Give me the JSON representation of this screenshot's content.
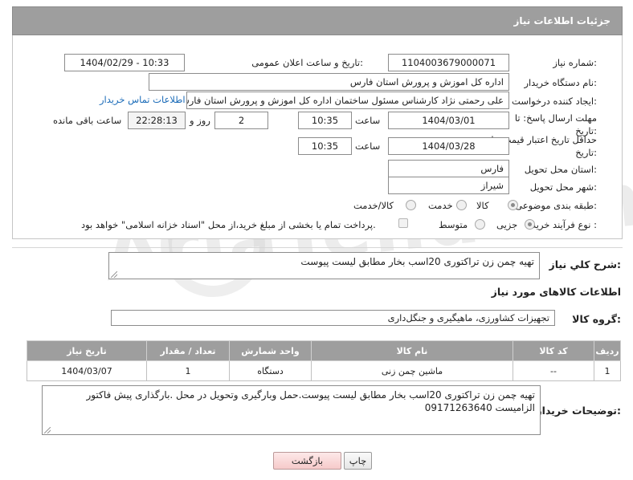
{
  "header": {
    "title": "جزئیات اطلاعات نیاز"
  },
  "fields": {
    "need_number": {
      "label": "شماره نیاز:",
      "value": "1104003679000071"
    },
    "announce_date": {
      "label": "تاریخ و ساعت اعلان عمومی:",
      "value": "1404/02/29 - 10:33"
    },
    "buyer_org": {
      "label": "نام دستگاه خریدار:",
      "value": "اداره کل اموزش و پرورش استان فارس"
    },
    "creator": {
      "label": "ایجاد کننده درخواست:",
      "value": "علی رحمتی نژاد کارشناس مسئول ساختمان اداره کل اموزش و پرورش استان فارس",
      "link": "اطلاعات تماس خریدار"
    },
    "reply_deadline": {
      "label": "مهلت ارسال پاسخ: تا تاریخ:",
      "date": "1404/03/01",
      "time_label": "ساعت",
      "time": "10:35",
      "days": "2",
      "days_label": "روز و",
      "remaining": "22:28:13",
      "remaining_label": "ساعت باقی مانده"
    },
    "price_deadline": {
      "label": "حداقل تاریخ اعتبار قیمت: تا تاریخ:",
      "date": "1404/03/28",
      "time_label": "ساعت",
      "time": "10:35"
    },
    "delivery_province": {
      "label": "استان محل تحویل:",
      "value": "فارس"
    },
    "delivery_city": {
      "label": "شهر محل تحویل:",
      "value": "شیراز"
    },
    "category": {
      "label": "طبقه بندی موضوعی:",
      "options": [
        "کالا",
        "خدمت",
        "کالا/خدمت"
      ],
      "selected": "کالا"
    },
    "process": {
      "label": "نوع فرآیند خرید :",
      "options": [
        "جزیی",
        "متوسط"
      ],
      "selected": "جزیی",
      "note": "پرداخت تمام یا بخشی از مبلغ خرید،از محل \"اسناد خزانه اسلامی\" خواهد بود."
    }
  },
  "description": {
    "label": "شرح کلي نياز:",
    "value": "تهیه چمن زن تراکتوری 20اسب بخار مطابق لیست پیوست"
  },
  "goods_section": {
    "title": "اطلاعات کالاهای مورد نیاز"
  },
  "goods_group": {
    "label": "گروه کالا:",
    "value": "تجهیزات کشاورزی، ماهیگیری و جنگل‌داری"
  },
  "table": {
    "headers": [
      "ردیف",
      "کد کالا",
      "نام کالا",
      "واحد شمارش",
      "تعداد / مقدار",
      "تاریخ نیاز"
    ],
    "rows": [
      [
        "1",
        "--",
        "ماشین چمن زنی",
        "دستگاه",
        "1",
        "1404/03/07"
      ]
    ]
  },
  "buyer_notes": {
    "label": "توضیحات خریدار:",
    "value": "تهیه چمن زن تراکتوری 20اسب بخار مطابق لیست پیوست.حمل وبارگیری وتحویل در محل .بارگذاری پیش فاکتور الزامیست 09171263640"
  },
  "buttons": {
    "print": "چاپ",
    "back": "بازگشت"
  },
  "watermark": {
    "text": "AriaTender.net"
  }
}
